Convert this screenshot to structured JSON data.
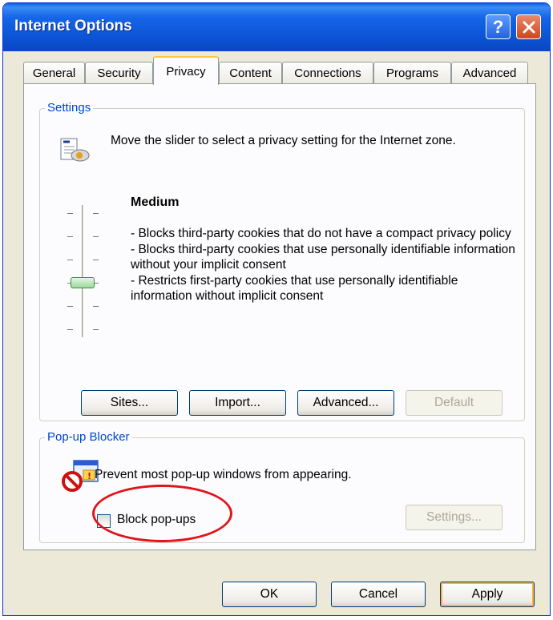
{
  "window": {
    "title": "Internet Options"
  },
  "tabs": [
    {
      "label": "General"
    },
    {
      "label": "Security"
    },
    {
      "label": "Privacy"
    },
    {
      "label": "Content"
    },
    {
      "label": "Connections"
    },
    {
      "label": "Programs"
    },
    {
      "label": "Advanced"
    }
  ],
  "active_tab": "Privacy",
  "settings": {
    "legend": "Settings",
    "intro": "Move the slider to select a privacy setting for the Internet zone.",
    "level_title": "Medium",
    "level_lines": [
      "- Blocks third-party cookies that do not have a compact privacy policy",
      "- Blocks third-party cookies that use personally identifiable information without your implicit consent",
      "- Restricts first-party cookies that use personally identifiable information without implicit consent"
    ],
    "slider_level": 3,
    "slider_level_count": 6,
    "buttons": {
      "sites": "Sites...",
      "import": "Import...",
      "advanced": "Advanced...",
      "default": "Default"
    }
  },
  "popup_blocker": {
    "legend": "Pop-up Blocker",
    "description": "Prevent most pop-up windows from appearing.",
    "checkbox_label": "Block pop-ups",
    "checkbox_checked": false,
    "settings_button": "Settings..."
  },
  "footer": {
    "ok": "OK",
    "cancel": "Cancel",
    "apply": "Apply"
  },
  "colors": {
    "title_bar": "#0a5ee6",
    "group_legend": "#0046d5",
    "highlight": "#e0141a",
    "close_button": "#d0461b"
  },
  "icons": {
    "privacy": "privacy-document-icon",
    "popup": "popup-blocked-icon",
    "help": "help-icon",
    "close": "close-icon"
  }
}
